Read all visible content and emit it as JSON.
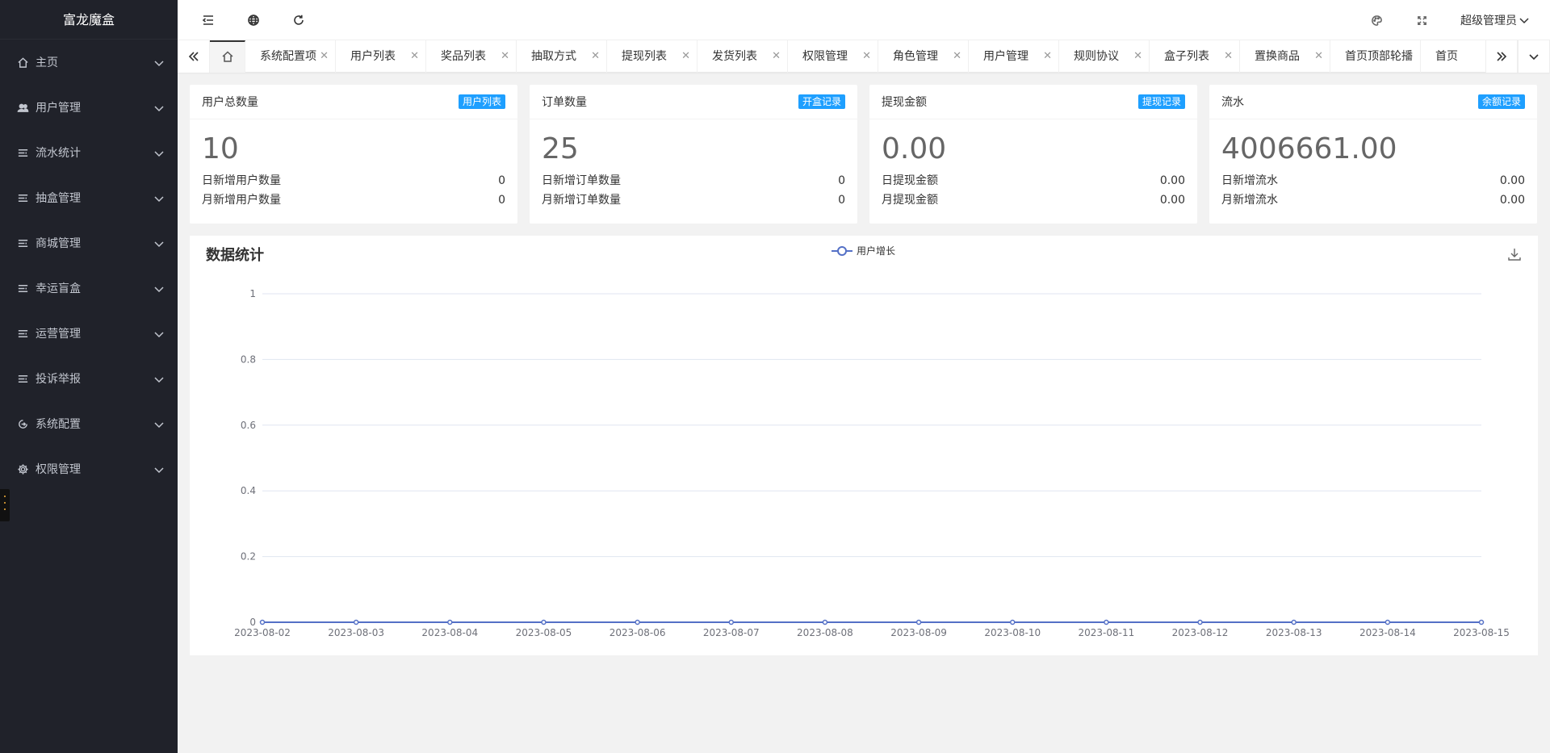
{
  "app": {
    "title": "富龙魔盒"
  },
  "sidebar": {
    "items": [
      {
        "label": "主页",
        "icon": "home-icon"
      },
      {
        "label": "用户管理",
        "icon": "users-icon"
      },
      {
        "label": "流水统计",
        "icon": "list-icon"
      },
      {
        "label": "抽盒管理",
        "icon": "list-icon"
      },
      {
        "label": "商城管理",
        "icon": "list-icon"
      },
      {
        "label": "幸运盲盒",
        "icon": "list-icon"
      },
      {
        "label": "运营管理",
        "icon": "list-icon"
      },
      {
        "label": "投诉举报",
        "icon": "list-icon"
      },
      {
        "label": "系统配置",
        "icon": "circle-arrow-icon"
      },
      {
        "label": "权限管理",
        "icon": "gear-icon"
      }
    ]
  },
  "header": {
    "user": "超级管理员"
  },
  "tabs": [
    {
      "label": "系统配置项"
    },
    {
      "label": "用户列表"
    },
    {
      "label": "奖品列表"
    },
    {
      "label": "抽取方式"
    },
    {
      "label": "提现列表"
    },
    {
      "label": "发货列表"
    },
    {
      "label": "权限管理"
    },
    {
      "label": "角色管理"
    },
    {
      "label": "用户管理"
    },
    {
      "label": "规则协议"
    },
    {
      "label": "盒子列表"
    },
    {
      "label": "置换商品"
    },
    {
      "label": "首页顶部轮播"
    },
    {
      "label": "首页"
    }
  ],
  "cards": [
    {
      "title": "用户总数量",
      "badge": "用户列表",
      "value": "10",
      "rows": [
        {
          "label": "日新增用户数量",
          "value": "0"
        },
        {
          "label": "月新增用户数量",
          "value": "0"
        }
      ]
    },
    {
      "title": "订单数量",
      "badge": "开盒记录",
      "value": "25",
      "rows": [
        {
          "label": "日新增订单数量",
          "value": "0"
        },
        {
          "label": "月新增订单数量",
          "value": "0"
        }
      ]
    },
    {
      "title": "提现金额",
      "badge": "提现记录",
      "value": "0.00",
      "rows": [
        {
          "label": "日提现金额",
          "value": "0.00"
        },
        {
          "label": "月提现金额",
          "value": "0.00"
        }
      ]
    },
    {
      "title": "流水",
      "badge": "余额记录",
      "value": "4006661.00",
      "rows": [
        {
          "label": "日新增流水",
          "value": "0.00"
        },
        {
          "label": "月新增流水",
          "value": "0.00"
        }
      ]
    }
  ],
  "chart": {
    "title": "数据统计",
    "legend": "用户增长"
  },
  "colors": {
    "accent": "#1e9fff",
    "sidebar": "#20222a",
    "series": "#5470c6"
  },
  "chart_data": {
    "type": "line",
    "title": "数据统计",
    "categories": [
      "2023-08-02",
      "2023-08-03",
      "2023-08-04",
      "2023-08-05",
      "2023-08-06",
      "2023-08-07",
      "2023-08-08",
      "2023-08-09",
      "2023-08-10",
      "2023-08-11",
      "2023-08-12",
      "2023-08-13",
      "2023-08-14",
      "2023-08-15"
    ],
    "series": [
      {
        "name": "用户增长",
        "values": [
          0,
          0,
          0,
          0,
          0,
          0,
          0,
          0,
          0,
          0,
          0,
          0,
          0,
          0
        ]
      }
    ],
    "ylim": [
      0,
      1
    ],
    "yticks": [
      "0",
      "0.2",
      "0.4",
      "0.6",
      "0.8",
      "1"
    ],
    "grid": true,
    "legend_position": "top-center"
  }
}
